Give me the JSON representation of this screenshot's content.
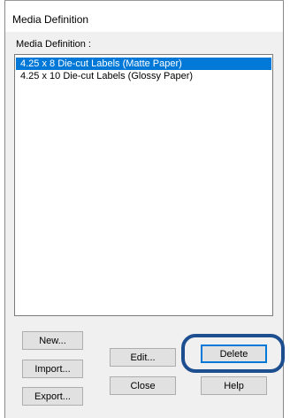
{
  "window": {
    "title": "Media Definition"
  },
  "media_list": {
    "caption": "Media Definition :",
    "items": [
      {
        "label": "4.25 x 8 Die-cut Labels (Matte Paper)",
        "selected": true
      },
      {
        "label": "4.25 x 10 Die-cut Labels (Glossy Paper)",
        "selected": false
      }
    ]
  },
  "buttons": {
    "new": "New...",
    "import": "Import...",
    "export": "Export...",
    "edit": "Edit...",
    "close": "Close",
    "delete": "Delete",
    "help": "Help"
  },
  "colors": {
    "selection": "#0078d7",
    "highlight_ring": "#1d4e8f"
  }
}
